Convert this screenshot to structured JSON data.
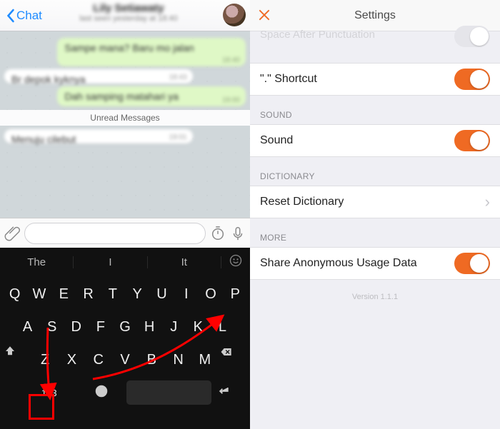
{
  "left": {
    "back_label": "Chat",
    "contact_name": "Lily Setiawaty",
    "contact_status": "last seen yesterday at 18:40",
    "messages": {
      "m1_text": "Sampe mana? Baru mo jalan",
      "m1_time": "18:40",
      "m2_text": "Br depok kyknya",
      "m2_time": "18:43",
      "m3_text": "Dah samping matahari ya",
      "m3_time": "19:00"
    },
    "unread_label": "Unread Messages",
    "m4_text": "Menuju cilebut",
    "m4_time": "19:01",
    "input_placeholder": "",
    "suggestions": [
      "The",
      "I",
      "It"
    ],
    "rows": {
      "r1": [
        "Q",
        "W",
        "E",
        "R",
        "T",
        "Y",
        "U",
        "I",
        "O",
        "P"
      ],
      "r2": [
        "A",
        "S",
        "D",
        "F",
        "G",
        "H",
        "J",
        "K",
        "L"
      ],
      "r3": [
        "Z",
        "X",
        "C",
        "V",
        "B",
        "N",
        "M"
      ]
    },
    "numkey_label": "123"
  },
  "right": {
    "title": "Settings",
    "ghost_row_label": "Space After Punctuation",
    "shortcut_label": "\".\" Shortcut",
    "sound_section": "SOUND",
    "sound_label": "Sound",
    "dict_section": "DICTIONARY",
    "reset_label": "Reset Dictionary",
    "more_section": "MORE",
    "share_label": "Share Anonymous Usage Data",
    "version": "Version 1.1.1"
  },
  "colors": {
    "accent": "#ef6a23",
    "ios_blue": "#1e8bff"
  }
}
